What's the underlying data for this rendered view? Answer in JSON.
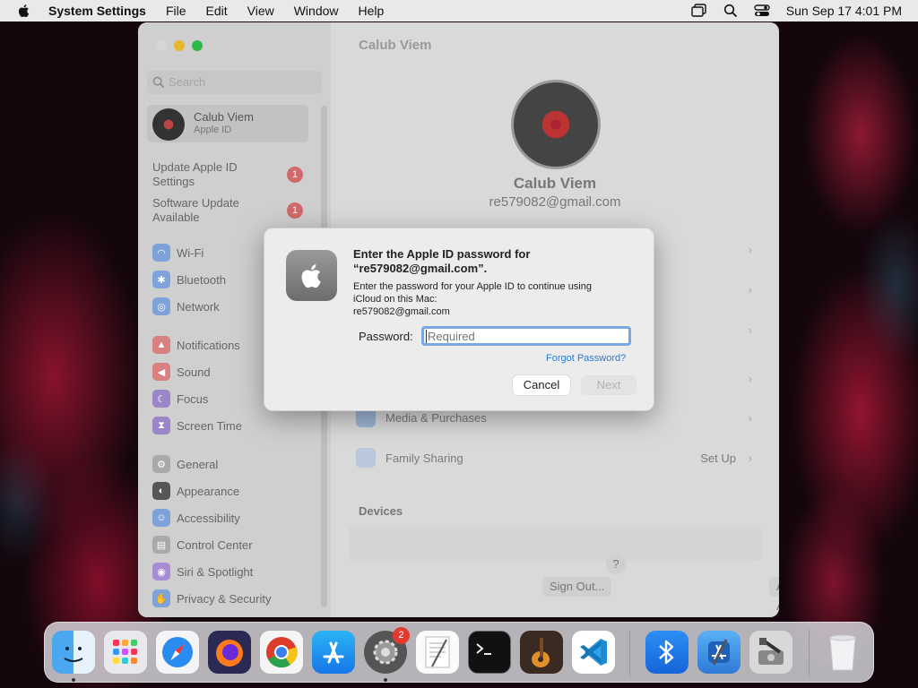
{
  "menubar": {
    "app": "System Settings",
    "items": [
      "File",
      "Edit",
      "View",
      "Window",
      "Help"
    ],
    "datetime": "Sun Sep 17  4:01 PM"
  },
  "window": {
    "title": "Calub Viem",
    "search_placeholder": "Search",
    "account": {
      "name": "Calub Viem",
      "sub": "Apple ID"
    },
    "updates": [
      {
        "label": "Update Apple ID Settings",
        "badge": "1"
      },
      {
        "label": "Software Update Available",
        "badge": "1"
      }
    ],
    "sidebar": {
      "network": [
        "Wi-Fi",
        "Bluetooth",
        "Network"
      ],
      "notify": [
        "Notifications",
        "Sound",
        "Focus",
        "Screen Time"
      ],
      "general": [
        "General",
        "Appearance",
        "Accessibility",
        "Control Center",
        "Siri & Spotlight",
        "Privacy & Security"
      ]
    },
    "profile": {
      "name": "Calub Viem",
      "email": "re579082@gmail.com"
    },
    "rows": {
      "media": "Media & Purchases",
      "family": "Family Sharing",
      "family_action": "Set Up"
    },
    "devices_heading": "Devices",
    "sign_out": "Sign Out...",
    "about": "About Apple ID & Privacy...",
    "help": "?"
  },
  "dialog": {
    "title": "Enter the Apple ID password for “re579082@gmail.com”.",
    "body_line1": "Enter the password for your Apple ID to continue using",
    "body_line2": "iCloud on this Mac:",
    "body_line3": "re579082@gmail.com",
    "password_label": "Password:",
    "password_placeholder": "Required",
    "forgot": "Forgot Password?",
    "cancel": "Cancel",
    "next": "Next"
  },
  "dock": {
    "settings_badge": "2"
  },
  "colors": {
    "menubar": "#e9e9ec",
    "accent": "#2a7bd3",
    "badge": "#e03b30"
  }
}
